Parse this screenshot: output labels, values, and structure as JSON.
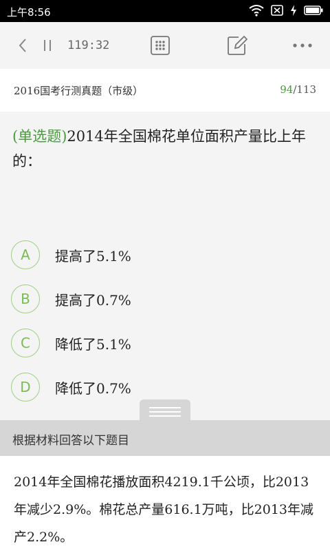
{
  "status_bar": {
    "time": "上午8:56",
    "icons": [
      "wifi-icon",
      "sim-x-icon",
      "charging-icon",
      "battery-icon"
    ]
  },
  "toolbar": {
    "timer": "119:32",
    "icons": [
      "back-icon",
      "pause-icon",
      "answer-sheet-icon",
      "edit-note-icon",
      "more-icon"
    ]
  },
  "exam": {
    "title": "2016国考行测真题（市级）",
    "current": "94",
    "total": "/113"
  },
  "question": {
    "type": "(单选题)",
    "text": "2014年全国棉花单位面积产量比上年的："
  },
  "options": [
    {
      "letter": "A",
      "text": "提高了5.1%"
    },
    {
      "letter": "B",
      "text": "提高了0.7%"
    },
    {
      "letter": "C",
      "text": "降低了5.1%"
    },
    {
      "letter": "D",
      "text": "降低了0.7%"
    }
  ],
  "material": {
    "header": "根据材料回答以下题目",
    "text": "2014年全国棉花播放面积4219.1千公顷，比2013年减少2.9%。棉花总产量616.1万吨，比2013年减产2.2%。"
  },
  "colors": {
    "accent": "#4a9a3e",
    "option_circle": "#9fcf84",
    "material_header_bg": "#d6d6d6"
  }
}
